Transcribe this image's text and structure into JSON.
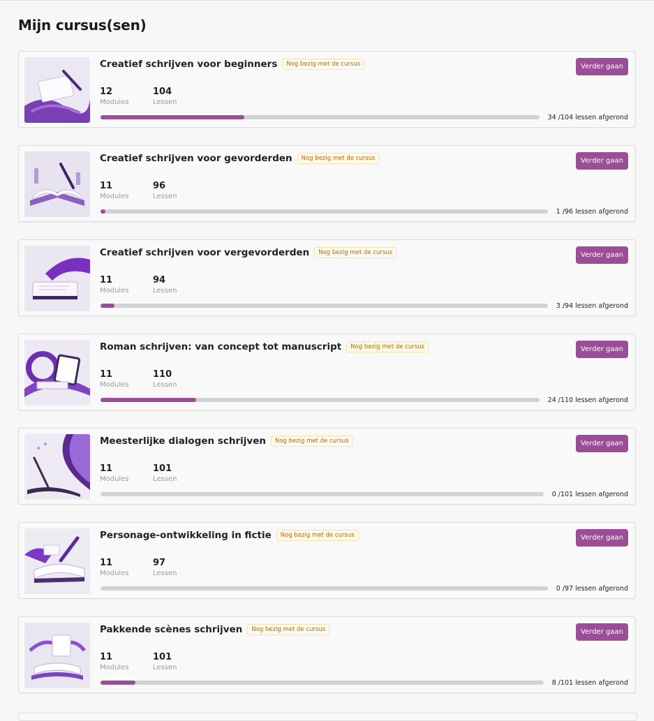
{
  "page": {
    "title": "Mijn cursus(sen)"
  },
  "courses": [
    {
      "title": "Creatief schrijven voor beginners",
      "status": "Nog bezig met de cursus",
      "modules": "12",
      "modules_label": "Modules",
      "lessons": "104",
      "lessons_label": "Lessen",
      "completed": 34,
      "total": 104,
      "progress_text": "34 /104 lessen afgerond",
      "button_label": "Verder gaan",
      "thumbnail_icon": "book-and-pen-illustration"
    },
    {
      "title": "Creatief schrijven voor gevorderden",
      "status": "Nog bezig met de cursus",
      "modules": "11",
      "modules_label": "Modules",
      "lessons": "96",
      "lessons_label": "Lessen",
      "completed": 1,
      "total": 96,
      "progress_text": "1 /96 lessen afgerond",
      "button_label": "Verder gaan",
      "thumbnail_icon": "open-book-pen-illustration"
    },
    {
      "title": "Creatief schrijven voor vergevorderden",
      "status": "Nog bezig met de cursus",
      "modules": "11",
      "modules_label": "Modules",
      "lessons": "94",
      "lessons_label": "Lessen",
      "completed": 3,
      "total": 94,
      "progress_text": "3 /94 lessen afgerond",
      "button_label": "Verder gaan",
      "thumbnail_icon": "tablet-ribbon-illustration"
    },
    {
      "title": "Roman schrijven: van concept tot manuscript",
      "status": "Nog bezig met de cursus",
      "modules": "11",
      "modules_label": "Modules",
      "lessons": "110",
      "lessons_label": "Lessen",
      "completed": 24,
      "total": 110,
      "progress_text": "24 /110 lessen afgerond",
      "button_label": "Verder gaan",
      "thumbnail_icon": "device-swirl-illustration"
    },
    {
      "title": "Meesterlijke dialogen schrijven",
      "status": "Nog bezig met de cursus",
      "modules": "11",
      "modules_label": "Modules",
      "lessons": "101",
      "lessons_label": "Lessen",
      "completed": 0,
      "total": 101,
      "progress_text": "0 /101 lessen afgerond",
      "button_label": "Verder gaan",
      "thumbnail_icon": "quill-swirl-illustration"
    },
    {
      "title": "Personage-ontwikkeling in fictie",
      "status": "Nog bezig met de cursus",
      "modules": "11",
      "modules_label": "Modules",
      "lessons": "97",
      "lessons_label": "Lessen",
      "completed": 0,
      "total": 97,
      "progress_text": "0 /97 lessen afgerond",
      "button_label": "Verder gaan",
      "thumbnail_icon": "book-fountain-pen-illustration"
    },
    {
      "title": "Pakkende scènes schrijven",
      "status": "Nog bezig met de cursus",
      "modules": "11",
      "modules_label": "Modules",
      "lessons": "101",
      "lessons_label": "Lessen",
      "completed": 8,
      "total": 101,
      "progress_text": "8 /101 lessen afgerond",
      "button_label": "Verder gaan",
      "thumbnail_icon": "scroll-book-illustration"
    }
  ],
  "colors": {
    "accent": "#9b4d96",
    "badge_text": "#b36b00",
    "badge_bg": "#fffaeb",
    "track": "#d2d2d6"
  }
}
